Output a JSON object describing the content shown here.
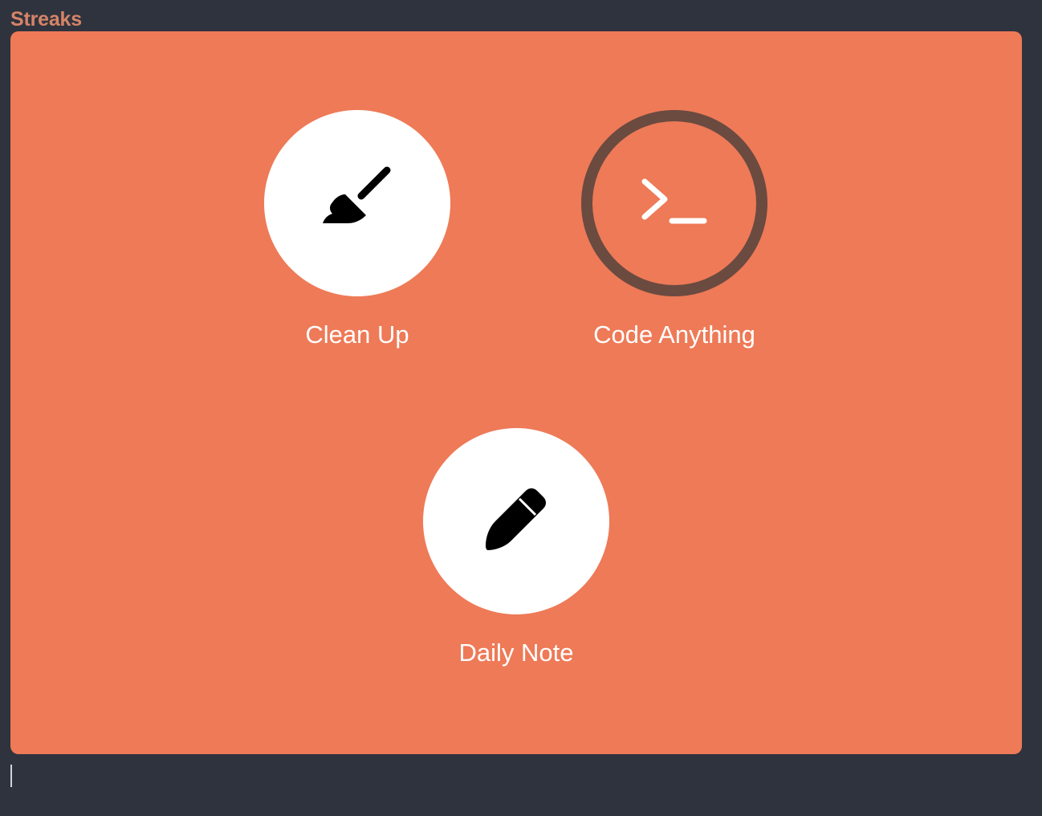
{
  "section": {
    "title": "Streaks"
  },
  "habits": [
    {
      "label": "Clean Up",
      "icon": "broom-icon",
      "completed": true
    },
    {
      "label": "Code Anything",
      "icon": "terminal-icon",
      "completed": false
    },
    {
      "label": "Daily Note",
      "icon": "pencil-icon",
      "completed": true
    }
  ],
  "colors": {
    "background": "#2f333e",
    "title": "#d68467",
    "panel": "#ee7a57",
    "completed_fill": "#ffffff",
    "incomplete_ring": "#6b4a40",
    "label": "#ffffff"
  }
}
